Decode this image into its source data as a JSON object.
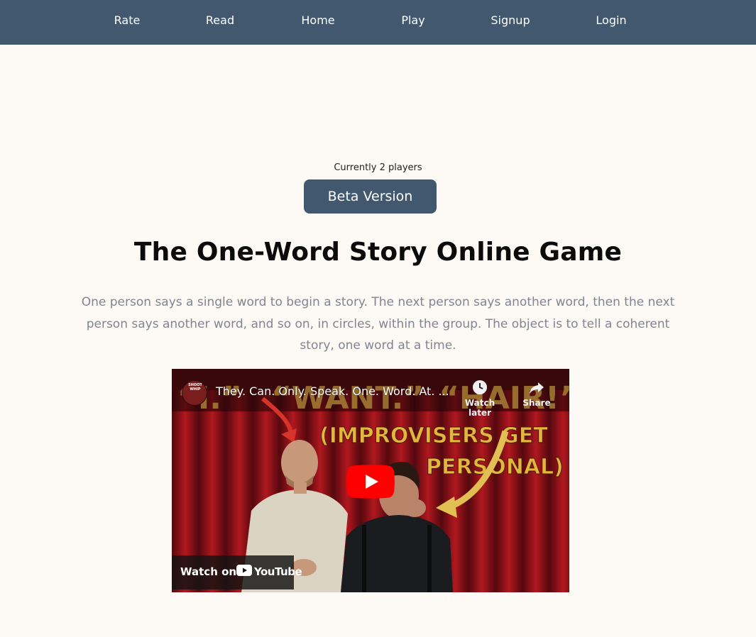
{
  "nav": {
    "items": [
      {
        "label": "Rate"
      },
      {
        "label": "Read"
      },
      {
        "label": "Home"
      },
      {
        "label": "Play"
      },
      {
        "label": "Signup"
      },
      {
        "label": "Login"
      }
    ]
  },
  "hero": {
    "players_text": "Currently 2 players",
    "beta_label": "Beta Version",
    "title": "The One-Word Story Online Game",
    "description": "One person says a single word to begin a story. The next person says another word, then the next person says another word, and so on, in circles, within the group. The object is to tell a coherent story, one word at a time."
  },
  "video": {
    "title": "They. Can. Only. Speak. One. Word. At. ...",
    "channel_badge": "SHOOT WHIP",
    "watch_later": "Watch later",
    "share": "Share",
    "watch_on": "Watch on",
    "youtube": "YouTube",
    "thumb_words": [
      "“I.”",
      "“WANT.”",
      "“HAIR!”"
    ],
    "thumb_caption_line1": "(IMPROVISERS GET",
    "thumb_caption_line2": "PERSONAL)",
    "colors": {
      "play_red": "#ff0000",
      "caption_yellow": "#f5c842",
      "curtain": "#8a1418"
    }
  },
  "colors": {
    "nav_bg": "#41586e",
    "page_bg": "#fdf9f4",
    "desc_text": "#808591"
  }
}
